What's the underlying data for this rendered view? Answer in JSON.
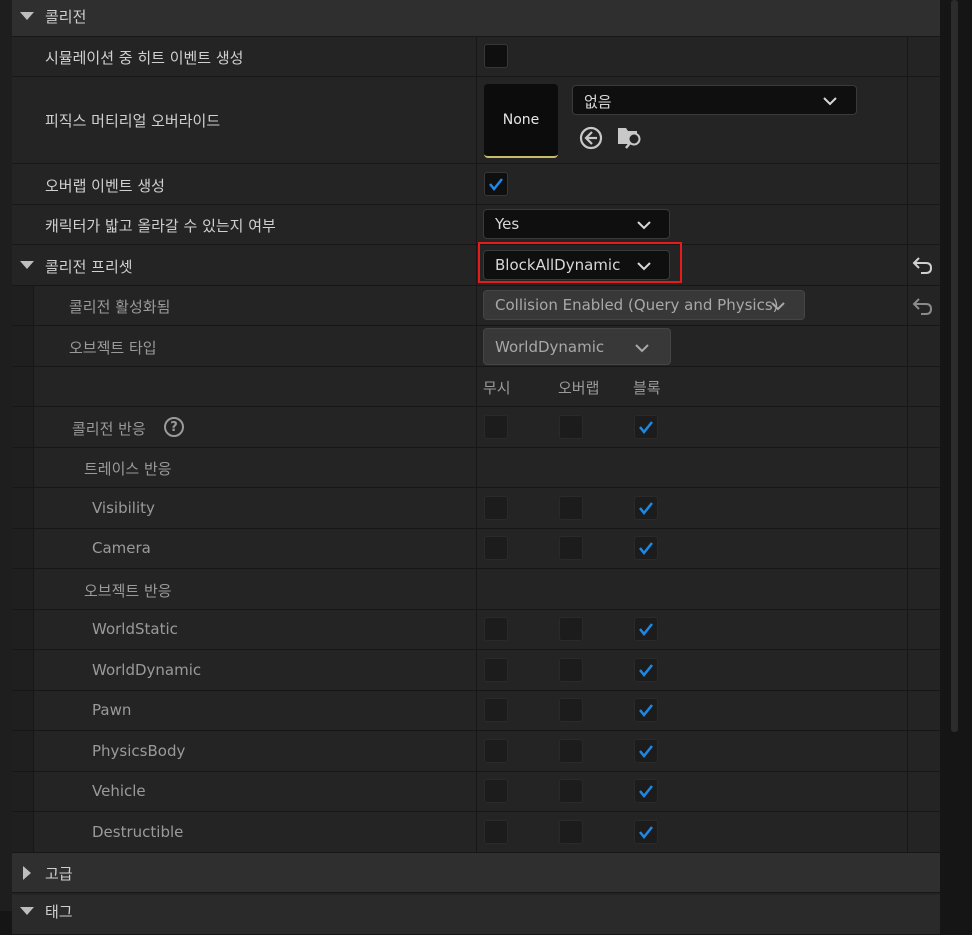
{
  "sections": {
    "collision": "콜리전",
    "advanced": "고급",
    "tags": "태그"
  },
  "props": {
    "sim_hit": {
      "label": "시뮬레이션 중 히트 이벤트 생성",
      "checked": false
    },
    "phys_mat": {
      "label": "피직스 머티리얼 오버라이드",
      "thumb": "None",
      "value": "없음"
    },
    "overlap": {
      "label": "오버랩 이벤트 생성",
      "checked": true
    },
    "step_up": {
      "label": "캐릭터가 밟고 올라갈 수 있는지 여부",
      "value": "Yes"
    }
  },
  "preset": {
    "label": "콜리전 프리셋",
    "value": "BlockAllDynamic",
    "enabled": {
      "label": "콜리전 활성화됨",
      "value": "Collision Enabled (Query and Physics)"
    },
    "object_type": {
      "label": "오브젝트 타입",
      "value": "WorldDynamic"
    },
    "columns": [
      "무시",
      "오버랩",
      "블록"
    ],
    "responses_label": "콜리전 반응",
    "help_glyph": "?",
    "trace_label": "트레이스 반응",
    "object_label": "오브젝트 반응",
    "trace_rows": [
      "Visibility",
      "Camera"
    ],
    "object_rows": [
      "WorldStatic",
      "WorldDynamic",
      "Pawn",
      "PhysicsBody",
      "Vehicle",
      "Destructible"
    ],
    "response": "블록"
  },
  "icons": {
    "expanded": "triangle-down-icon",
    "collapsed": "triangle-right-icon",
    "dropdown": "chevron-down-icon",
    "use_selected": "arrow-left-circle-icon",
    "browse": "folder-search-icon",
    "reset": "reset-arrow-icon",
    "help": "help-icon",
    "check": "checkmark-icon"
  },
  "colors": {
    "check": "#1e88e5",
    "highlight": "#e51c1c",
    "thumb_underline": "#c8bb6a"
  }
}
